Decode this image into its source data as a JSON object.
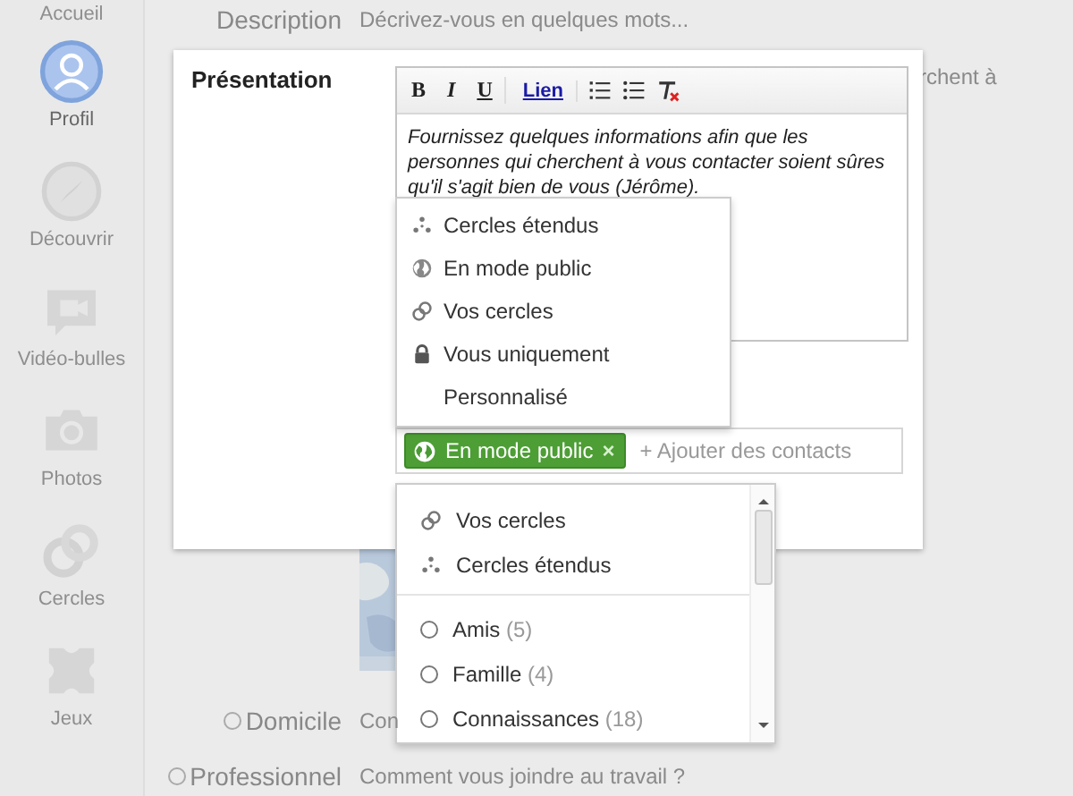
{
  "sidebar": {
    "items": [
      {
        "kind": "home",
        "label": "Accueil",
        "selected": false
      },
      {
        "kind": "profile",
        "label": "Profil",
        "selected": true
      },
      {
        "kind": "compass",
        "label": "Découvrir",
        "selected": false
      },
      {
        "kind": "video",
        "label": "Vidéo-bulles",
        "selected": false
      },
      {
        "kind": "camera",
        "label": "Photos",
        "selected": false
      },
      {
        "kind": "circles",
        "label": "Cercles",
        "selected": false
      },
      {
        "kind": "games",
        "label": "Jeux",
        "selected": false
      }
    ]
  },
  "description": {
    "label": "Description",
    "placeholder": "Décrivez-vous en quelques mots..."
  },
  "background_text": "rchent à",
  "presentation": {
    "label": "Présentation",
    "toolbar": [
      {
        "kind": "bold",
        "label": "B"
      },
      {
        "kind": "italic",
        "label": "I"
      },
      {
        "kind": "underline",
        "label": "U"
      },
      {
        "kind": "link",
        "label": "Lien"
      },
      {
        "kind": "numbered-list"
      },
      {
        "kind": "bullet-list"
      },
      {
        "kind": "clear-format"
      }
    ],
    "text": "Fournissez quelques informations afin que les personnes qui cherchent à vous contacter soient sûres qu'il s'agit bien de vous (Jérôme)."
  },
  "visibility_menu": {
    "items": [
      {
        "kind": "extended",
        "label": "Cercles étendus"
      },
      {
        "kind": "public",
        "label": "En mode public"
      },
      {
        "kind": "circles",
        "label": "Vos cercles"
      },
      {
        "kind": "private",
        "label": "Vous uniquement"
      },
      {
        "kind": "custom",
        "label": "Personnalisé"
      }
    ]
  },
  "audience": {
    "chips": [
      {
        "kind": "public",
        "label": "En mode public",
        "remove": "×"
      }
    ],
    "placeholder": "+ Ajouter des contacts"
  },
  "audience_dropdown": {
    "items": [
      {
        "kind": "circles",
        "label": "Vos cercles"
      },
      {
        "kind": "extended",
        "label": "Cercles étendus"
      }
    ],
    "circles": [
      {
        "name": "Amis",
        "count": "(5)",
        "selected": false
      },
      {
        "name": "Famille",
        "count": "(4)",
        "selected": false
      },
      {
        "name": "Connaissances",
        "count": "(18)",
        "selected": false
      }
    ]
  },
  "contact_rows": [
    {
      "label": "Domicile",
      "placeholder": "Con",
      "selected": false
    },
    {
      "label": "Professionnel",
      "placeholder": "Comment vous joindre au travail ?",
      "selected": false
    }
  ]
}
